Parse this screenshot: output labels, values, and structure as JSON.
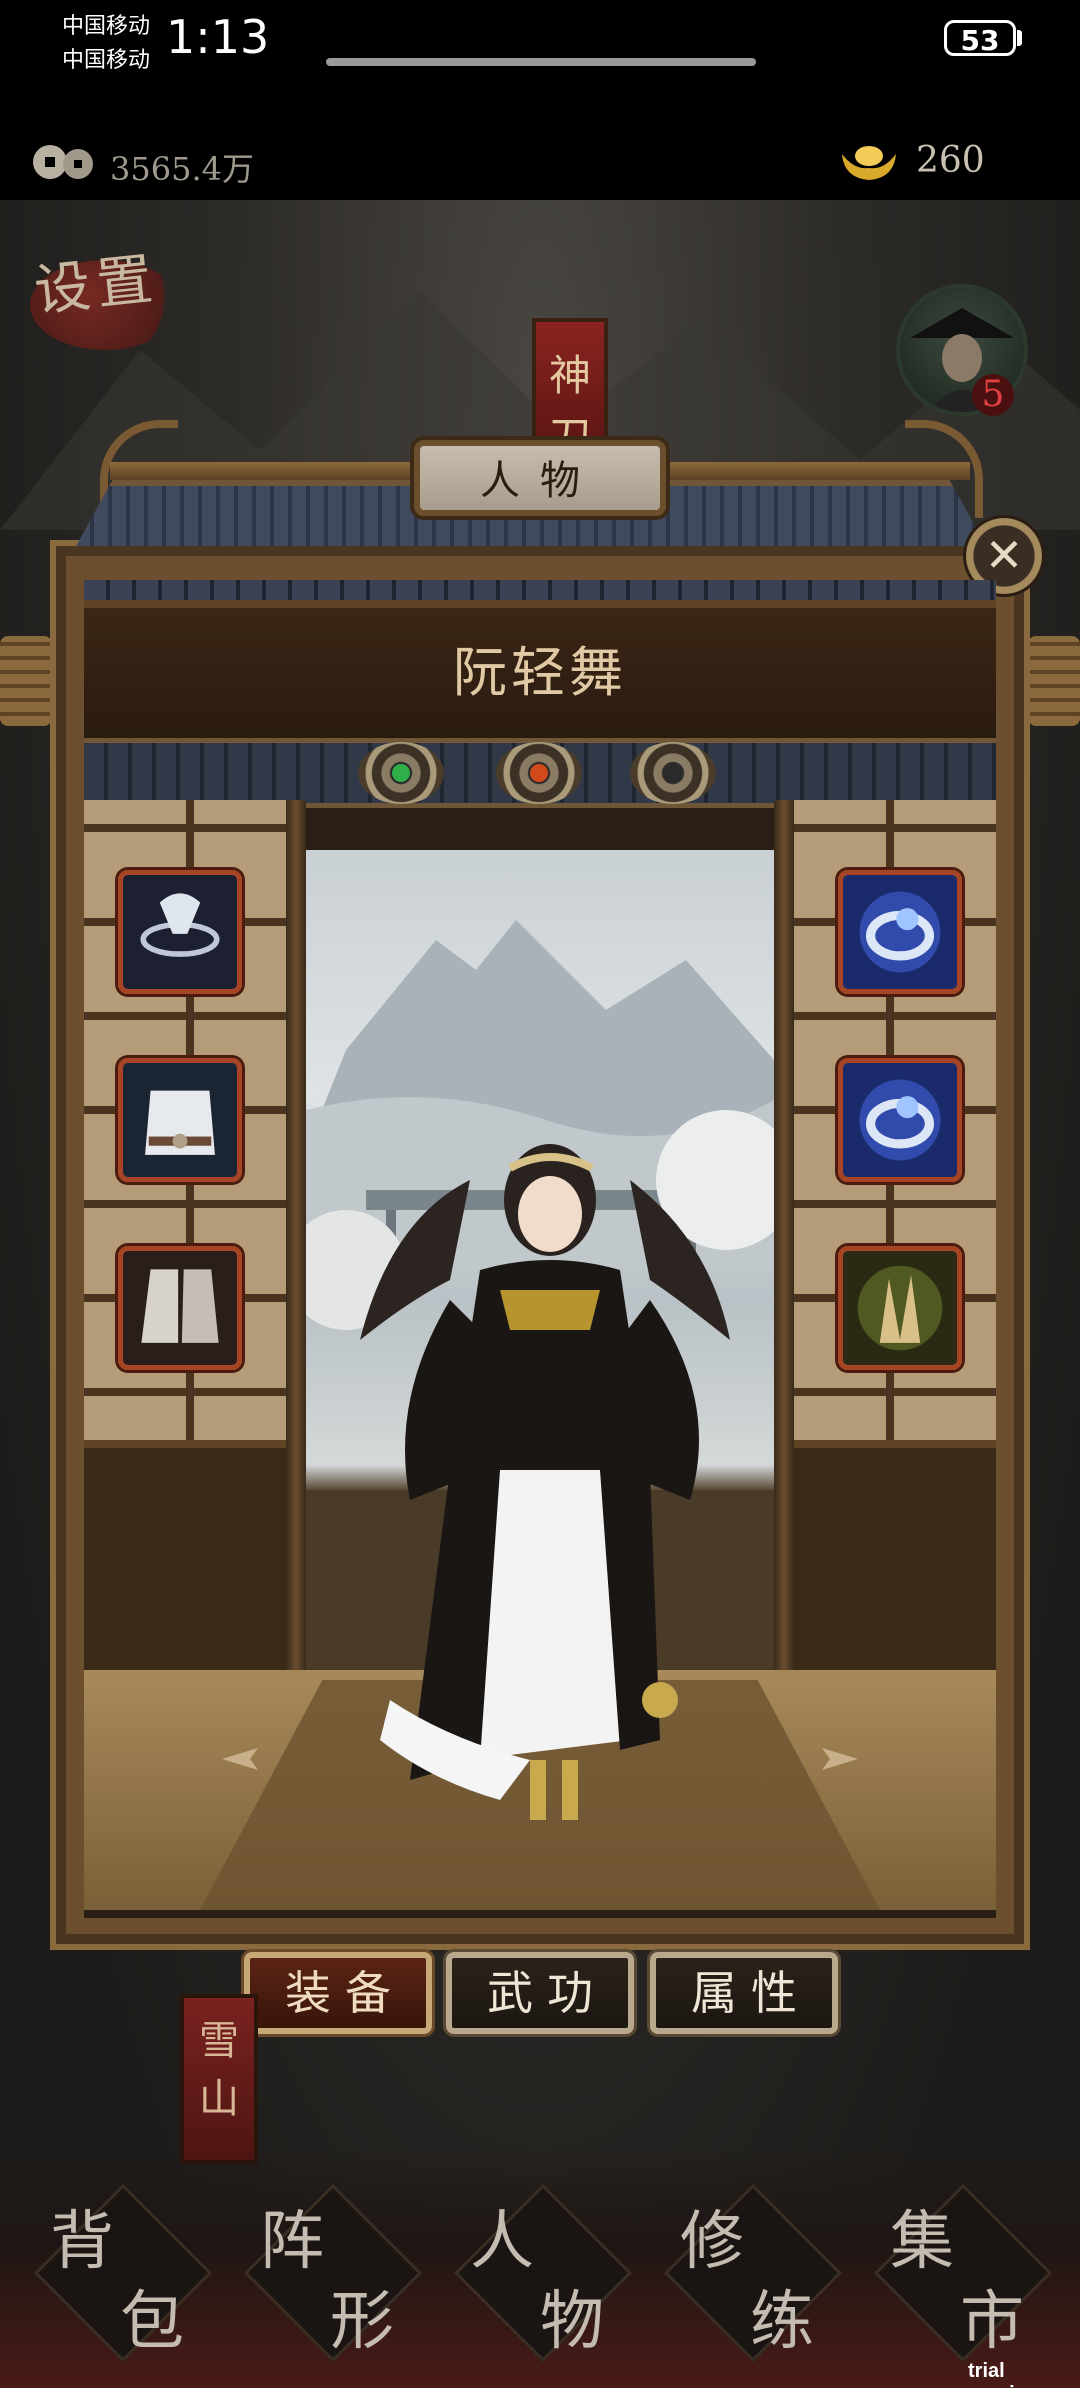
{
  "status_bar": {
    "carrier_1": "中国移动",
    "carrier_2": "中国移动",
    "time": "1:13",
    "battery": "53"
  },
  "currency": {
    "coins": "3565.4万",
    "ingots": "260",
    "coin_icon": "copper-coins-icon",
    "ingot_icon": "gold-ingot-icon"
  },
  "background": {
    "settings_label": "设置",
    "shendao_label": "神刀",
    "boss_level": "5",
    "xueshan_label": "雪山"
  },
  "panel": {
    "title": "人物",
    "character_name": "阮轻舞",
    "close_icon": "close-icon",
    "orbs": [
      {
        "name": "green-orb",
        "color": "#2fae4a"
      },
      {
        "name": "red-orb",
        "color": "#d24a1a"
      },
      {
        "name": "dark-orb",
        "color": "#2a2a2a"
      }
    ],
    "left_slots": [
      "helmet-slot",
      "armor-slot",
      "boots-slot"
    ],
    "right_slots": [
      "ring-slot-1",
      "ring-slot-2",
      "accessory-slot"
    ]
  },
  "tabs": [
    {
      "label": "装备",
      "active": true
    },
    {
      "label": "武功",
      "active": false
    },
    {
      "label": "属性",
      "active": false
    }
  ],
  "bottom_nav": [
    {
      "label_1": "背",
      "label_2": "包"
    },
    {
      "label_1": "阵",
      "label_2": "形"
    },
    {
      "label_1": "人",
      "label_2": "物"
    },
    {
      "label_1": "修",
      "label_2": "练"
    },
    {
      "label_1": "集",
      "label_2": "市"
    }
  ],
  "watermark": "trial version"
}
